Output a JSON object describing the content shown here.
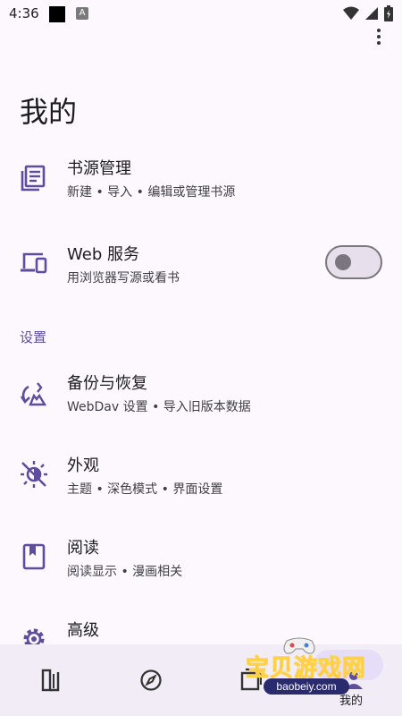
{
  "status_bar": {
    "time": "4:36",
    "notif_a_label": "A",
    "icons": [
      "wifi-icon",
      "signal-icon",
      "battery-icon"
    ]
  },
  "page": {
    "title": "我的"
  },
  "items": {
    "book_source": {
      "title": "书源管理",
      "subtitle": "新建 • 导入 • 编辑或管理书源",
      "icon": "list-document-icon"
    },
    "web_service": {
      "title": "Web 服务",
      "subtitle": "用浏览器写源或看书",
      "icon": "devices-icon",
      "toggle_on": false
    },
    "backup": {
      "title": "备份与恢复",
      "subtitle": "WebDav 设置 • 导入旧版本数据",
      "icon": "backup-restore-icon"
    },
    "appearance": {
      "title": "外观",
      "subtitle": "主题 • 深色模式 • 界面设置",
      "icon": "theme-icon"
    },
    "reading": {
      "title": "阅读",
      "subtitle": "阅读显示 • 漫画相关",
      "icon": "bookmark-book-icon"
    },
    "advanced": {
      "title": "高级",
      "icon": "gear-icon"
    }
  },
  "section": {
    "settings_label": "设置"
  },
  "bottom_nav": {
    "items": [
      {
        "icon": "bookshelf-icon",
        "label": ""
      },
      {
        "icon": "compass-icon",
        "label": ""
      },
      {
        "icon": "rss-icon",
        "label": ""
      },
      {
        "icon": "person-icon",
        "label": "我的",
        "active": true
      }
    ]
  },
  "watermark": {
    "text": "宝贝游戏网",
    "url": "baobeiy.com"
  },
  "colors": {
    "background": "#fcf8fe",
    "accent": "#5d4d9a",
    "nav_background": "#f1ecf5",
    "active_pill": "#e6def8"
  }
}
